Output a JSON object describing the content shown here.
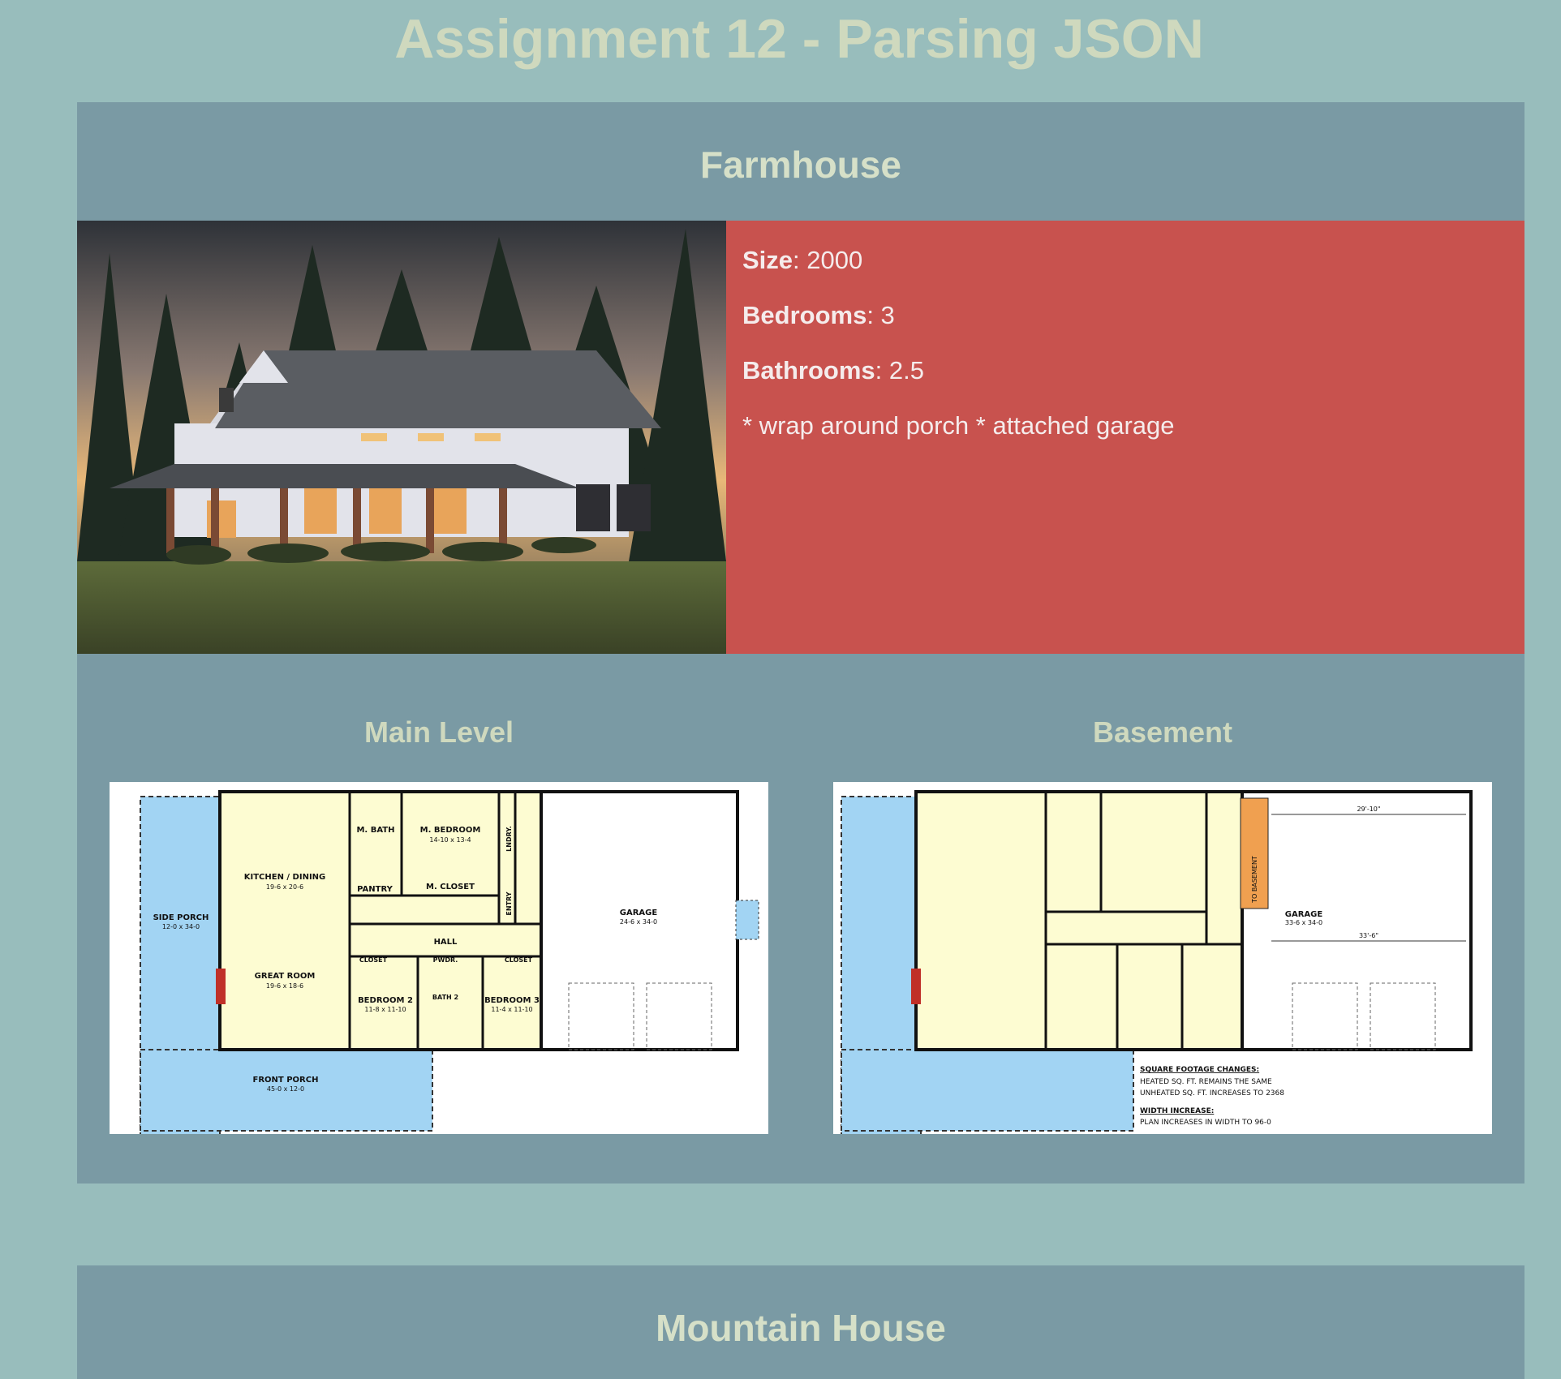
{
  "page": {
    "title": "Assignment 12 - Parsing JSON"
  },
  "houses": [
    {
      "name": "Farmhouse",
      "size_label": "Size",
      "size": "2000",
      "bedrooms_label": "Bedrooms",
      "bedrooms": "3",
      "bathrooms_label": "Bathrooms",
      "bathrooms": "2.5",
      "features": "* wrap around porch * attached garage",
      "floor_plans": [
        {
          "name": "Main Level",
          "labels": {
            "kitchen": "KITCHEN / DINING",
            "kitchen_dim": "19-6 x 20-6",
            "side_porch": "SIDE PORCH",
            "side_porch_dim": "12-0 x 34-0",
            "great_room": "GREAT ROOM",
            "great_room_dim": "19-6 x 18-6",
            "m_bath": "M. BATH",
            "m_bedroom": "M. BEDROOM",
            "m_bedroom_dim": "14-10 x 13-4",
            "pantry": "PANTRY",
            "m_closet": "M. CLOSET",
            "hall": "HALL",
            "closet": "CLOSET",
            "pwdr": "PWDR.",
            "bedroom2": "BEDROOM 2",
            "bedroom2_dim": "11-8 x 11-10",
            "bath2": "BATH 2",
            "bedroom3": "BEDROOM 3",
            "bedroom3_dim": "11-4 x 11-10",
            "garage": "GARAGE",
            "garage_dim": "24-6 x 34-0",
            "front_porch": "FRONT PORCH",
            "front_porch_dim": "45-0 x 12-0",
            "laundry": "LNDRY.",
            "entry": "ENTRY"
          }
        },
        {
          "name": "Basement",
          "labels": {
            "garage": "GARAGE",
            "garage_dim": "33-6 x 34-0",
            "width_top": "29'-10\"",
            "width_bottom": "33'-6\"",
            "stair": "TO BASEMENT",
            "sq_heading": "SQUARE FOOTAGE CHANGES:",
            "sq_line1": "HEATED SQ. FT. REMAINS THE SAME",
            "sq_line2": "UNHEATED SQ. FT. INCREASES TO 2368",
            "width_heading": "WIDTH INCREASE:",
            "width_line": "PLAN INCREASES IN WIDTH TO 96-0"
          }
        }
      ]
    },
    {
      "name": "Mountain House"
    }
  ],
  "colors": {
    "page_bg": "#98bdbc",
    "card_bg": "#7a9aa4",
    "details_bg": "#c8524e",
    "heading_text": "#cfd9be"
  }
}
